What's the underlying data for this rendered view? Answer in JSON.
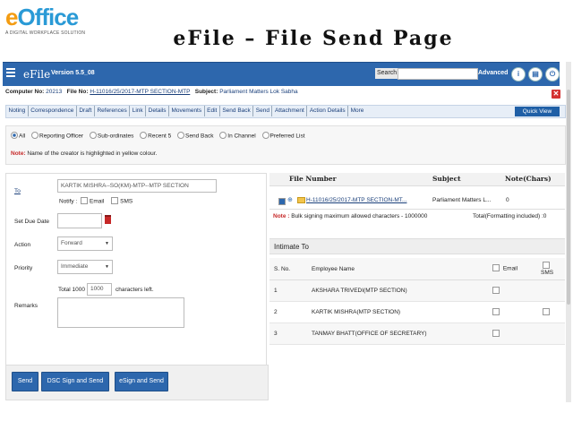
{
  "logo": {
    "text_e": "e",
    "text_rest": "Office",
    "tagline": "A DIGITAL WORKPLACE SOLUTION"
  },
  "headline": "eFile – File Send Page",
  "appbar": {
    "title": "eFile",
    "version": "Version 5.5_08",
    "search_label": "Search",
    "search_value": "",
    "advanced_label": "Advanced",
    "icons": [
      "info-icon",
      "document-icon",
      "power-icon"
    ]
  },
  "info": {
    "computer_no_label": "Computer No:",
    "computer_no": "20213",
    "file_no_label": "File No:",
    "file_no": "H-11016/25/2017-MTP SECTION-MTP",
    "subject_label": "Subject:",
    "subject": "Parliament Matters Lok Sabha"
  },
  "nav": {
    "items": [
      "Noting",
      "Correspondence",
      "Draft",
      "References",
      "Link",
      "Details",
      "Movements",
      "Edit",
      "Send Back",
      "Send",
      "Attachment",
      "Action Details",
      "More"
    ],
    "quick_view": "Quick View"
  },
  "filter": {
    "options": [
      {
        "label": "All",
        "selected": true
      },
      {
        "label": "Reporting Officer",
        "selected": false
      },
      {
        "label": "Sub-ordinates",
        "selected": false
      },
      {
        "label": "Recent 5",
        "selected": false
      },
      {
        "label": "Send Back",
        "selected": false
      },
      {
        "label": "In Channel",
        "selected": false
      },
      {
        "label": "Preferred List",
        "selected": false
      }
    ],
    "note_label": "Note:",
    "note_text": "Name of the creator is highlighted in yellow colour."
  },
  "form": {
    "to_label": "To",
    "to_value": "KARTIK MISHRA--SO(KM)-MTP--MTP SECTION",
    "notify_label": "Notify :",
    "email_label": "Email",
    "sms_label": "SMS",
    "due_label": "Set Due Date",
    "due_value": "",
    "action_label": "Action",
    "action_value": "Forward",
    "priority_label": "Priority",
    "priority_value": "Immediate",
    "total_label": "Total 1000 |",
    "remaining": "1000",
    "chars_left": "characters left.",
    "remarks_label": "Remarks",
    "remarks_value": ""
  },
  "buttons": {
    "send": "Send",
    "dsc": "DSC Sign and Send",
    "esign": "eSign and Send"
  },
  "file_table": {
    "headers": {
      "file_number": "File Number",
      "subject": "Subject",
      "note": "Note(Chars)"
    },
    "row": {
      "file_number": "H-11016/25/2017-MTP SECTION-MT...",
      "subject": "Parliament Matters L...",
      "note": "0"
    },
    "note_label": "Note :",
    "note_text": "Bulk signing maximum allowed characters - 1000000",
    "total_text": "Total(Formatting included) :0"
  },
  "intimate": {
    "title": "Intimate To",
    "headers": {
      "sno": "S. No.",
      "name": "Employee Name",
      "email": "Email",
      "sms": "SMS"
    },
    "rows": [
      {
        "sno": "1",
        "name": "AKSHARA TRIVEDI(MTP SECTION)"
      },
      {
        "sno": "2",
        "name": "KARTIK MISHRA(MTP SECTION)"
      },
      {
        "sno": "3",
        "name": "TANMAY BHATT(OFFICE OF SECRETARY)"
      }
    ]
  },
  "colors": {
    "primary": "#2d67ad",
    "accent_red": "#c62828",
    "logo_blue": "#2a9ad6",
    "logo_orange": "#f39c12"
  }
}
